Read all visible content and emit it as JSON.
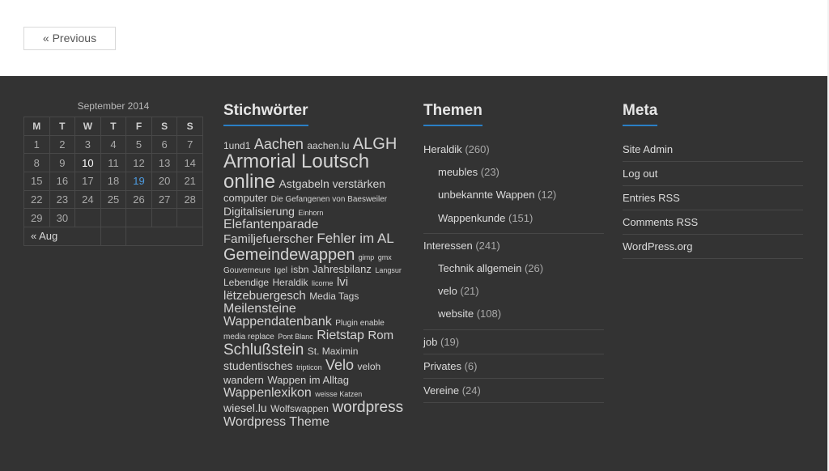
{
  "nav": {
    "previous_label": "« Previous"
  },
  "calendar": {
    "caption": "September 2014",
    "weekdays": [
      "M",
      "T",
      "W",
      "T",
      "F",
      "S",
      "S"
    ],
    "rows": [
      [
        "1",
        "2",
        "3",
        "4",
        "5",
        "6",
        "7"
      ],
      [
        "8",
        "9",
        "10",
        "11",
        "12",
        "13",
        "14"
      ],
      [
        "15",
        "16",
        "17",
        "18",
        "19",
        "20",
        "21"
      ],
      [
        "22",
        "23",
        "24",
        "25",
        "26",
        "27",
        "28"
      ],
      [
        "29",
        "30",
        "",
        "",
        "",
        "",
        ""
      ]
    ],
    "prev_month_label": "« Aug"
  },
  "tags_widget": {
    "title": "Stichwörter",
    "tags": [
      "1und1",
      "Aachen",
      "aachen.lu",
      "ALGH",
      "Armorial Loutsch online",
      "Astgabeln verstärken",
      "computer",
      "Die Gefangenen von Baesweiler",
      "Digitalisierung",
      "Einhorn",
      "Elefantenparade",
      "Familjefuerscher",
      "Fehler im AL",
      "Gemeindewappen",
      "gimp",
      "gmx",
      "Gouverneure",
      "Igel",
      "isbn",
      "Jahresbilanz",
      "Langsur",
      "Lebendige",
      "Heraldik",
      "licorne",
      "lvi",
      "lëtzebuergesch",
      "Media Tags",
      "Meilensteine",
      "Wappendatenbank",
      "Plugin enable media replace",
      "Pont Blanc",
      "Rietstap",
      "Rom",
      "Schlußstein",
      "St. Maximin",
      "studentisches",
      "tripticon",
      "Velo",
      "veloh",
      "wandern",
      "Wappen im Alltag",
      "Wappenlexikon",
      "weisse Katzen",
      "wiesel.lu",
      "Wolfswappen",
      "wordpress",
      "Wordpress Theme"
    ]
  },
  "themen_widget": {
    "title": "Themen",
    "items": [
      {
        "label": "Heraldik",
        "count": "(260)",
        "children": [
          {
            "label": "meubles",
            "count": "(23)"
          },
          {
            "label": "unbekannte Wappen",
            "count": "(12)"
          },
          {
            "label": "Wappenkunde",
            "count": "(151)"
          }
        ]
      },
      {
        "label": "Interessen",
        "count": "(241)",
        "children": [
          {
            "label": "Technik allgemein",
            "count": "(26)"
          },
          {
            "label": "velo",
            "count": "(21)"
          },
          {
            "label": "website",
            "count": "(108)"
          }
        ]
      },
      {
        "label": "job",
        "count": "(19)"
      },
      {
        "label": "Privates",
        "count": "(6)"
      },
      {
        "label": "Vereine",
        "count": "(24)"
      }
    ]
  },
  "meta_widget": {
    "title": "Meta",
    "items": [
      "Site Admin",
      "Log out",
      "Entries RSS",
      "Comments RSS",
      "WordPress.org"
    ]
  },
  "colors": {
    "footer_bg": "#333333",
    "accent": "#2a7fc5",
    "calendar_link": "#4d9be0"
  }
}
